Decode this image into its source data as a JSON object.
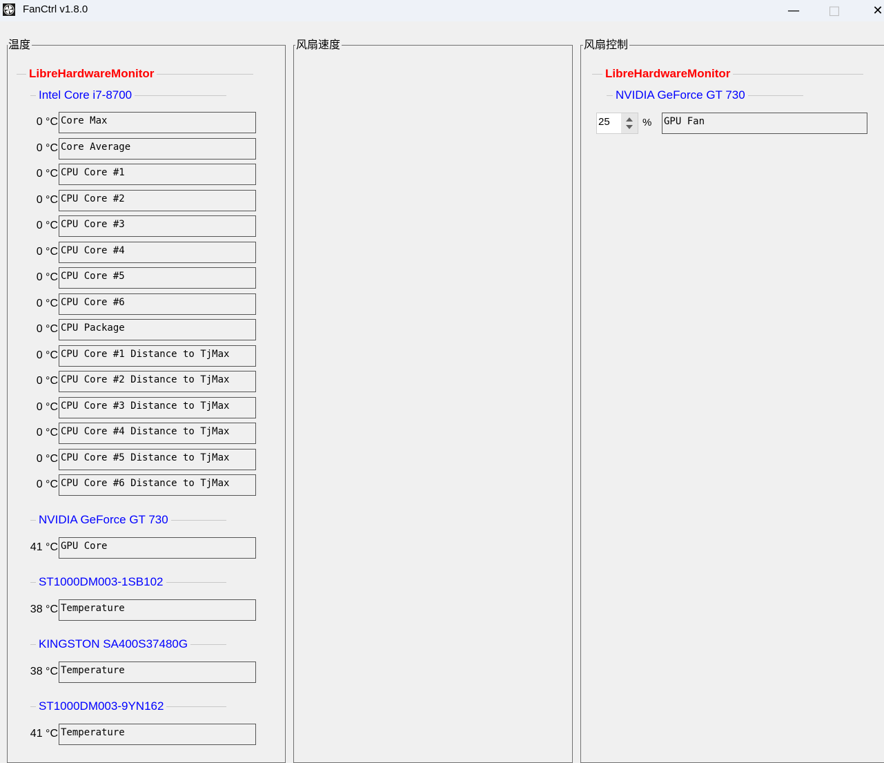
{
  "window": {
    "title": "FanCtrl v1.8.0",
    "icon": "fan-icon",
    "controls": [
      "minimize-icon",
      "maximize-icon",
      "close-icon"
    ]
  },
  "groups": {
    "temperature": "温度",
    "fan_speed": "风扇速度",
    "fan_control": "风扇控制"
  },
  "temperature": {
    "source": "LibreHardwareMonitor",
    "cpu": {
      "name": "Intel Core i7-8700",
      "sensors": [
        {
          "value": "0 °C",
          "label": "Core Max"
        },
        {
          "value": "0 °C",
          "label": "Core Average"
        },
        {
          "value": "0 °C",
          "label": "CPU Core #1"
        },
        {
          "value": "0 °C",
          "label": "CPU Core #2"
        },
        {
          "value": "0 °C",
          "label": "CPU Core #3"
        },
        {
          "value": "0 °C",
          "label": "CPU Core #4"
        },
        {
          "value": "0 °C",
          "label": "CPU Core #5"
        },
        {
          "value": "0 °C",
          "label": "CPU Core #6"
        },
        {
          "value": "0 °C",
          "label": "CPU Package"
        },
        {
          "value": "0 °C",
          "label": "CPU Core #1 Distance to TjMax"
        },
        {
          "value": "0 °C",
          "label": "CPU Core #2 Distance to TjMax"
        },
        {
          "value": "0 °C",
          "label": "CPU Core #3 Distance to TjMax"
        },
        {
          "value": "0 °C",
          "label": "CPU Core #4 Distance to TjMax"
        },
        {
          "value": "0 °C",
          "label": "CPU Core #5 Distance to TjMax"
        },
        {
          "value": "0 °C",
          "label": "CPU Core #6 Distance to TjMax"
        }
      ]
    },
    "gpu": {
      "name": "NVIDIA GeForce GT 730",
      "sensors": [
        {
          "value": "41 °C",
          "label": "GPU Core"
        }
      ]
    },
    "disk1": {
      "name": "ST1000DM003-1SB102",
      "sensors": [
        {
          "value": "38 °C",
          "label": "Temperature"
        }
      ]
    },
    "disk2": {
      "name": "KINGSTON SA400S37480G",
      "sensors": [
        {
          "value": "38 °C",
          "label": "Temperature"
        }
      ]
    },
    "disk3": {
      "name": "ST1000DM003-9YN162",
      "sensors": [
        {
          "value": "41 °C",
          "label": "Temperature"
        }
      ]
    }
  },
  "fan_control": {
    "source": "LibreHardwareMonitor",
    "device": "NVIDIA GeForce GT 730",
    "value": "25",
    "unit": "%",
    "label": "GPU Fan"
  },
  "colors": {
    "source_header": "#ff0000",
    "device_header": "#0000ff"
  }
}
